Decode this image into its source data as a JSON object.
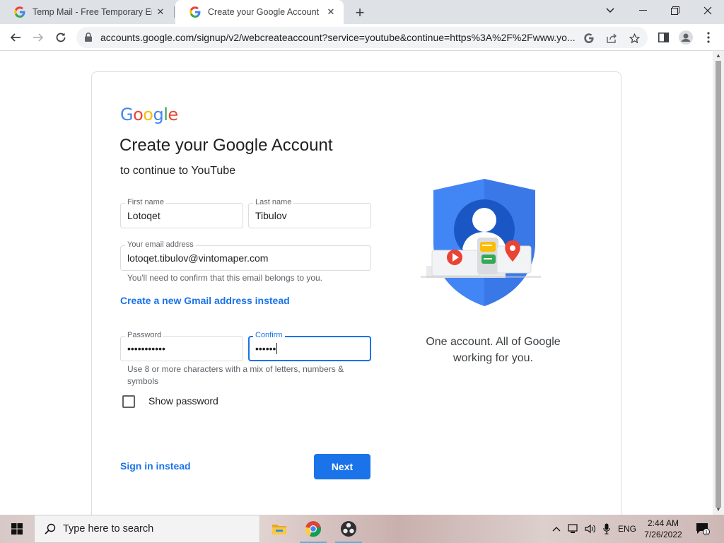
{
  "browser": {
    "tabs": [
      {
        "title": "Temp Mail - Free Temporary Ema",
        "active": false
      },
      {
        "title": "Create your Google Account",
        "active": true
      }
    ],
    "url": "accounts.google.com/signup/v2/webcreateaccount?service=youtube&continue=https%3A%2F%2Fwww.yo..."
  },
  "page": {
    "logo": {
      "letters": [
        "G",
        "o",
        "o",
        "g",
        "l",
        "e"
      ],
      "colors": [
        "#4285f4",
        "#ea4335",
        "#fbbc05",
        "#4285f4",
        "#34a853",
        "#ea4335"
      ]
    },
    "heading": "Create your Google Account",
    "subheading": "to continue to YouTube",
    "first_name": {
      "label": "First name",
      "value": "Lotoqet"
    },
    "last_name": {
      "label": "Last name",
      "value": "Tibulov"
    },
    "email": {
      "label": "Your email address",
      "value": "lotoqet.tibulov@vintomaper.com",
      "helper": "You'll need to confirm that this email belongs to you."
    },
    "gmail_link": "Create a new Gmail address instead",
    "password": {
      "label": "Password",
      "value": "•••••••••••"
    },
    "confirm": {
      "label": "Confirm",
      "value": "••••••"
    },
    "password_helper": "Use 8 or more characters with a mix of letters, numbers & symbols",
    "show_password": "Show password",
    "sign_in_link": "Sign in instead",
    "next_button": "Next",
    "tagline_line1": "One account. All of Google",
    "tagline_line2": "working for you."
  },
  "taskbar": {
    "search_placeholder": "Type here to search",
    "language": "ENG",
    "time": "2:44 AM",
    "date": "7/26/2022",
    "notification_count": "1"
  },
  "colors": {
    "accent": "#1a73e8",
    "border": "#dadce0",
    "text": "#202124"
  }
}
